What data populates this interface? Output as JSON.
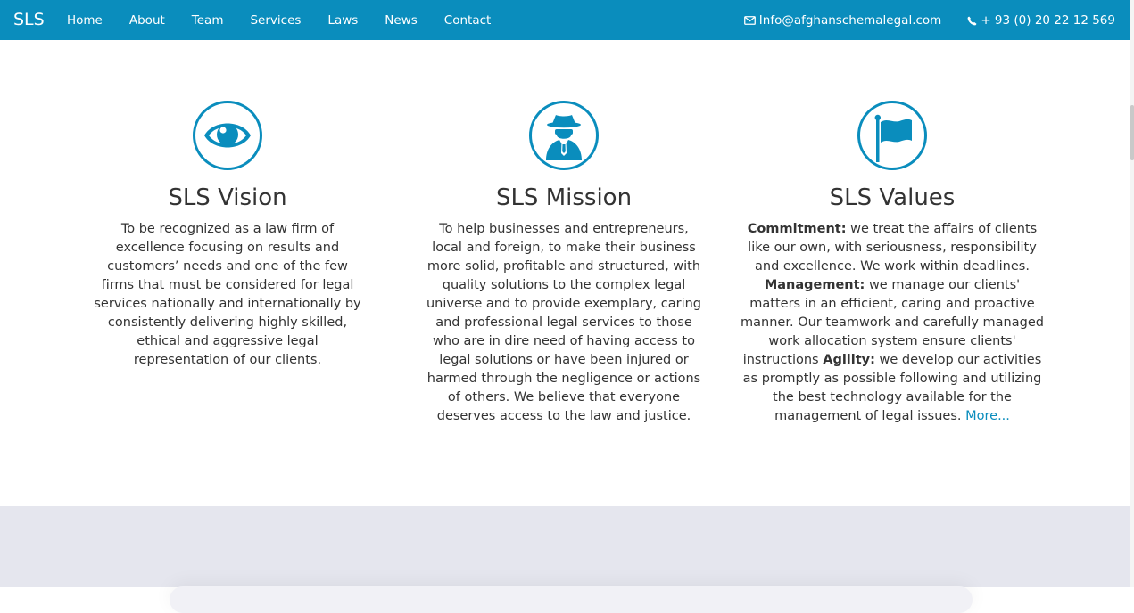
{
  "navbar": {
    "brand": "SLS",
    "links": [
      "Home",
      "About",
      "Team",
      "Services",
      "Laws",
      "News",
      "Contact"
    ],
    "email": "Info@afghanschemalegal.com",
    "phone": "+ 93 (0) 20 22 12 569"
  },
  "sections": {
    "vision": {
      "icon": "eye-icon",
      "title": "SLS Vision",
      "text": "To be recognized as a law firm of excellence focusing on results and customers’ needs and one of the few firms that must be considered for legal services nationally and internationally by consistently delivering highly skilled, ethical and aggressive legal representation of our clients."
    },
    "mission": {
      "icon": "spy-icon",
      "title": "SLS Mission",
      "text": "To help businesses and entrepreneurs, local and foreign, to make their business more solid, profitable and structured, with quality solutions to the complex legal universe and to provide exemplary, caring and professional legal services to those who are in dire need of having access to legal solutions or have been injured or harmed through the negligence or actions of others. We believe that everyone deserves access to the law and justice."
    },
    "values": {
      "icon": "flag-icon",
      "title": "SLS Values",
      "commitment_label": "Commitment:",
      "commitment_text": " we treat the affairs of clients like our own, with seriousness, responsibility and excellence. We work within deadlines.",
      "management_label": "Management:",
      "management_text": " we manage our clients' matters in an efficient, caring and proactive manner. Our teamwork and carefully managed work allocation system ensure clients' instructions",
      "agility_label": "Agility:",
      "agility_text": " we develop our activities as promptly as possible following and utilizing the best technology available for the management of legal issues. ",
      "more_link": "More..."
    }
  },
  "colors": {
    "accent": "#0a8dbd",
    "text": "#333333",
    "bottom_band": "#e5e6ee"
  }
}
